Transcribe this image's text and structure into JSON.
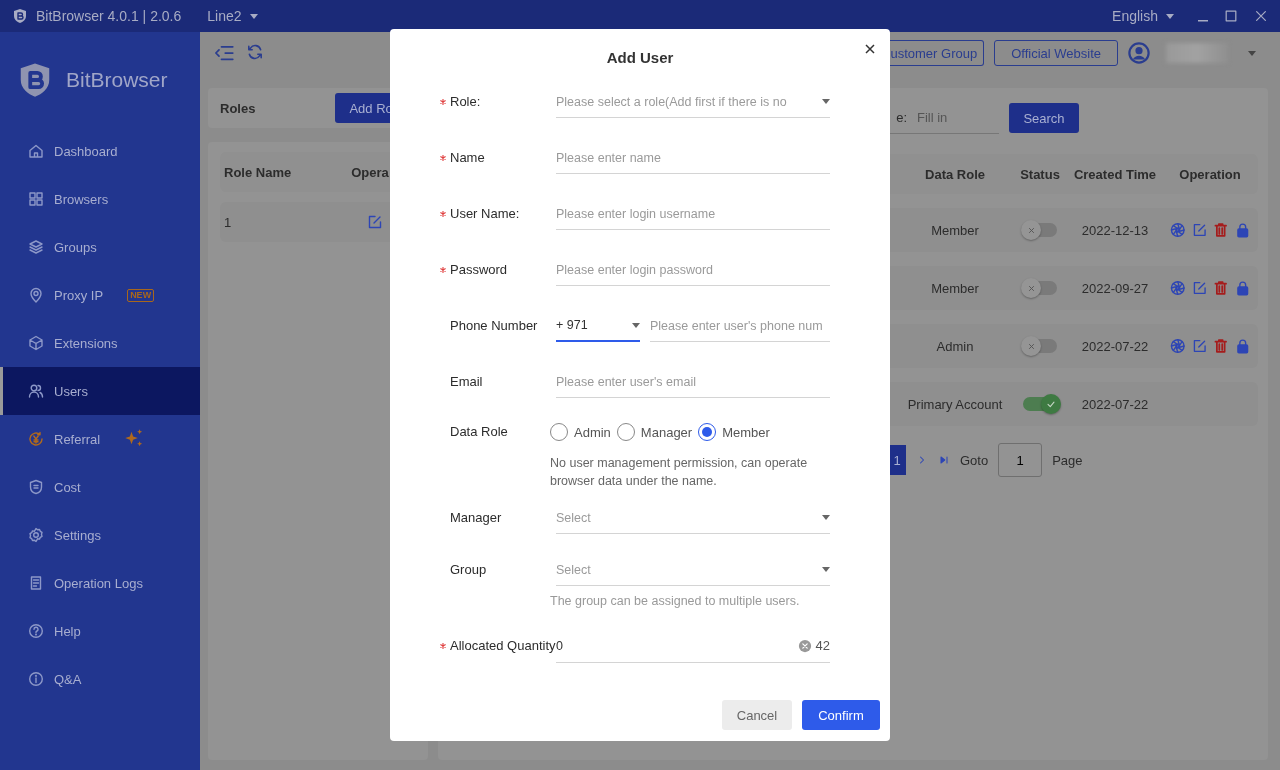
{
  "title_bar": {
    "app_title": "BitBrowser 4.0.1 | 2.0.6",
    "line": "Line2",
    "language": "English"
  },
  "sidebar": {
    "brand": "BitBrowser",
    "items": [
      {
        "label": "Dashboard",
        "selected": false
      },
      {
        "label": "Browsers",
        "selected": false
      },
      {
        "label": "Groups",
        "selected": false
      },
      {
        "label": "Proxy IP",
        "selected": false,
        "badge": "NEW"
      },
      {
        "label": "Extensions",
        "selected": false
      },
      {
        "label": "Users",
        "selected": true
      },
      {
        "label": "Referral",
        "selected": false,
        "sparkle": true
      },
      {
        "label": "Cost",
        "selected": false
      },
      {
        "label": "Settings",
        "selected": false
      },
      {
        "label": "Operation Logs",
        "selected": false
      },
      {
        "label": "Help",
        "selected": false
      },
      {
        "label": "Q&A",
        "selected": false
      }
    ]
  },
  "toolbar": {
    "buttons": [
      "ustomer Group",
      "Official Website"
    ]
  },
  "roles_panel": {
    "title": "Roles",
    "add_button": "Add Ro",
    "columns": [
      "Role Name",
      "Opera"
    ],
    "rows": [
      {
        "role_name": "1"
      }
    ]
  },
  "users_panel": {
    "search_label": "e:",
    "search_placeholder": "Fill in",
    "search_button": "Search",
    "columns": [
      "Data Role",
      "Status",
      "Created Time",
      "Operation"
    ],
    "rows": [
      {
        "data_role": "Member",
        "on": false,
        "created": "2022-12-13",
        "actions": true
      },
      {
        "data_role": "Member",
        "on": false,
        "created": "2022-09-27",
        "actions": true
      },
      {
        "data_role": "Admin",
        "on": false,
        "created": "2022-07-22",
        "actions": true
      },
      {
        "data_role": "Primary Account",
        "on": true,
        "created": "2022-07-22",
        "actions": false
      }
    ],
    "pagination": {
      "current": "1",
      "goto_label": "Goto",
      "goto_value": "1",
      "page_label": "Page"
    }
  },
  "dialog": {
    "title": "Add User",
    "fields": [
      {
        "kind": "select",
        "label": "Role:",
        "required": true,
        "placeholder": "Please select a role(Add first if there is no"
      },
      {
        "kind": "text",
        "label": "Name",
        "required": true,
        "placeholder": "Please enter name"
      },
      {
        "kind": "text",
        "label": "User Name:",
        "required": true,
        "placeholder": "Please enter login username"
      },
      {
        "kind": "text",
        "label": "Password",
        "required": true,
        "placeholder": "Please enter login password"
      },
      {
        "kind": "phone",
        "label": "Phone Number",
        "required": false,
        "code": "+ 971",
        "placeholder": "Please enter user's phone num"
      },
      {
        "kind": "text",
        "label": "Email",
        "required": false,
        "placeholder": "Please enter user's email"
      },
      {
        "kind": "radio",
        "label": "Data Role",
        "required": false,
        "options": [
          {
            "label": "Admin",
            "selected": false
          },
          {
            "label": "Manager",
            "selected": false
          },
          {
            "label": "Member",
            "selected": true
          }
        ],
        "hint": "No user management permission, can operate browser data under the name."
      },
      {
        "kind": "select",
        "label": "Manager",
        "required": false,
        "placeholder": "Select"
      },
      {
        "kind": "select",
        "label": "Group",
        "required": false,
        "placeholder": "Select",
        "hint": "The group can be assigned to multiple users."
      },
      {
        "kind": "number",
        "label": "Allocated Quantity",
        "required": true,
        "value": "0",
        "suffix": "42"
      }
    ],
    "buttons": [
      "Cancel",
      "Confirm"
    ]
  }
}
